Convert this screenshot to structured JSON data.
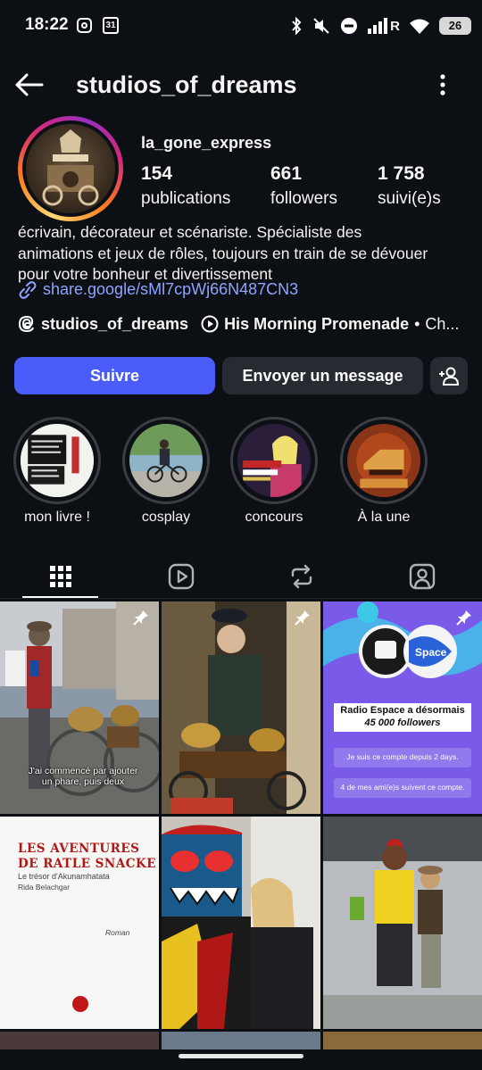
{
  "status_bar": {
    "time": "18:22",
    "calendar_day": "31",
    "network": "R",
    "battery": "26"
  },
  "header": {
    "handle": "studios_of_dreams"
  },
  "profile": {
    "username": "la_gone_express",
    "stats": [
      {
        "value": "154",
        "label": "publications"
      },
      {
        "value": "661",
        "label": "followers"
      },
      {
        "value": "1 758",
        "label": "suivi(e)s"
      }
    ],
    "bio_lines": [
      "écrivain, décorateur et scénariste. Spécialiste des",
      "animations et jeux de rôles, toujours en train de se dévouer",
      "pour votre bonheur et divertissement"
    ],
    "link": "share.google/sMl7cpWj66N487CN3",
    "threads_handle": "studios_of_dreams",
    "music_title": "His Morning Promenade",
    "music_more": "Ch..."
  },
  "actions": {
    "follow_label": "Suivre",
    "message_label": "Envoyer un message"
  },
  "highlights": [
    {
      "label": "mon livre !"
    },
    {
      "label": "cosplay"
    },
    {
      "label": "concours"
    },
    {
      "label": "À la une"
    }
  ],
  "posts": {
    "post1_caption": "J'ai commencé par ajouter un phare, puis deux",
    "post3_title": "Radio Espace a désormais",
    "post3_count": "45 000 followers",
    "post3_line1": "Je suis ce compte depuis 2 days.",
    "post3_line2": "4 de mes ami(e)s suivent ce compte.",
    "post3_logo": "Space",
    "post4_title1": "LES AVENTURES",
    "post4_title2": "DE RATLE SNACKE",
    "post4_subtitle": "Le trésor d'Akunamhatata",
    "post4_author": "Rida Belachgar",
    "post4_genre": "Roman"
  },
  "colors": {
    "background": "#0c0f14",
    "follow_button": "#4a5df9",
    "secondary_button": "#262a31",
    "link": "#8fa4ff"
  }
}
